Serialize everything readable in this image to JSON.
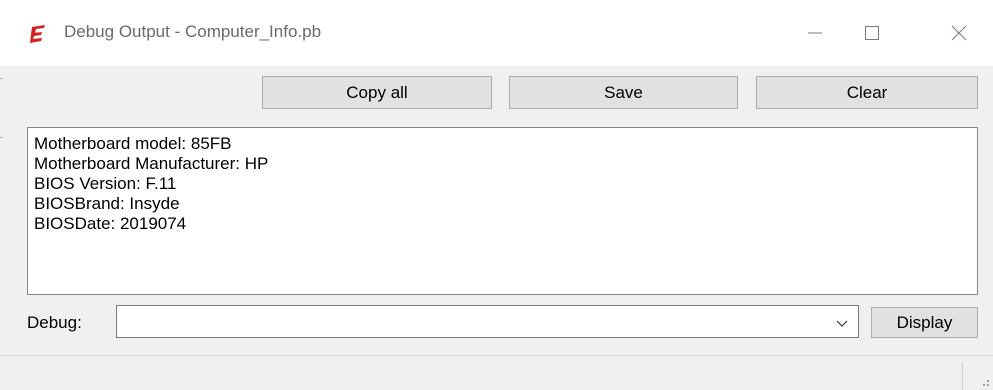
{
  "window": {
    "title": "Debug Output - Computer_Info.pb",
    "icon": "purebasic-e-icon",
    "controls": {
      "minimize": "minimize-icon",
      "maximize": "maximize-icon",
      "close": "close-icon"
    }
  },
  "toolbar": {
    "copy_all_label": "Copy all",
    "save_label": "Save",
    "clear_label": "Clear"
  },
  "output": {
    "lines": [
      "Motherboard model: 85FB",
      "Motherboard Manufacturer: HP",
      "BIOS Version: F.11",
      "BIOSBrand: Insyde",
      "BIOSDate: 2019074"
    ]
  },
  "debug": {
    "label": "Debug:",
    "value": "",
    "display_label": "Display"
  },
  "colors": {
    "title_text": "#6a6a6a",
    "icon_accent": "#d32020",
    "button_face": "#e1e1e1",
    "button_border": "#adadad"
  }
}
